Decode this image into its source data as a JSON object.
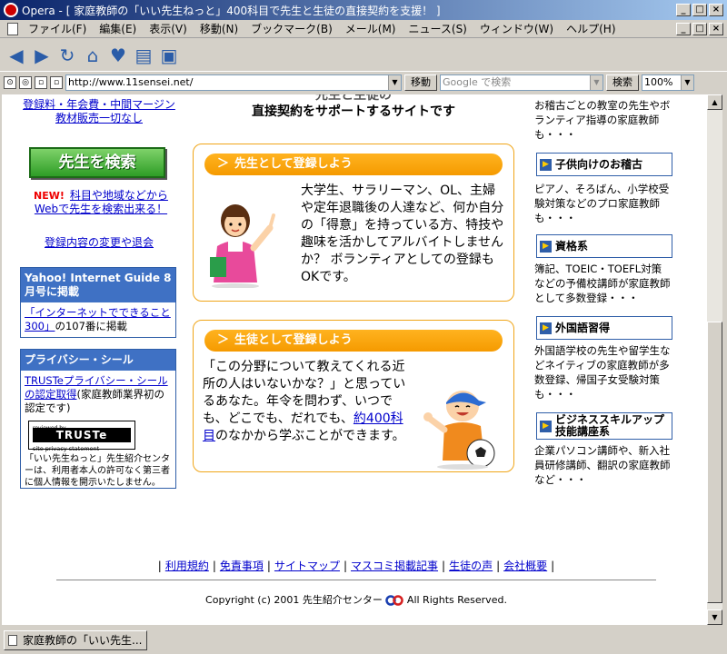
{
  "window": {
    "title": "Opera - [ 家庭教師の「いい先生ねっと」400科目で先生と生徒の直接契約を支援！ ]",
    "minimize": "_",
    "maximize": "□",
    "close": "×"
  },
  "menu": [
    "ファイル(F)",
    "編集(E)",
    "表示(V)",
    "移動(N)",
    "ブックマーク(B)",
    "メール(M)",
    "ニュース(S)",
    "ウィンドウ(W)",
    "ヘルプ(H)"
  ],
  "addressbar": {
    "url": "http://www.11sensei.net/",
    "go_label": "移動",
    "search_placeholder": "Google で検索",
    "search_label": "検索",
    "zoom": "100%"
  },
  "left": {
    "top_link_1": "登録料・年会費・中間マージン",
    "top_link_2": "教材販売一切なし",
    "search_button": "先生を検索",
    "new_badge": "NEW!",
    "new_text_1": "科目や地域などから",
    "new_text_2": "Webで先生を検索出来る！",
    "change_link": "登録内容の変更や退会",
    "yahoo_head": "Yahoo! Internet Guide 8月号に掲載",
    "yahoo_link": "「インターネットでできること300」",
    "yahoo_suffix": "の107番に掲載",
    "privacy_head": "プライバシー・シール",
    "truste_link": "TRUSTeプライバシー・シールの認定取得",
    "truste_suffix": "(家庭教師業界初の認定です)",
    "truste_reviewed": "reviewed by",
    "truste_logo": "TRUSTe",
    "truste_sub": "site privacy statement",
    "privacy_note": "「いい先生ねっと」先生紹介センターは、利用者本人の許可なく第三者に個人情報を開示いたしません。"
  },
  "center": {
    "head_line_1": "先生と生徒の",
    "head_line_2": "直接契約をサポートするサイトです",
    "teacher_title": "先生として登録しよう",
    "teacher_text": "大学生、サラリーマン、OL、主婦や定年退職後の人達など、何か自分の「得意」を持っている方、特技や趣味を活かしてアルバイトしませんか？ ボランティアとしての登録もOKです。",
    "student_title": "生徒として登録しよう",
    "student_text_1": "「この分野について教えてくれる近所の人はいないかな？」と思っているあなた。年令を問わず、いつでも、どこでも、だれでも、",
    "student_link": "約400科目",
    "student_text_2": "のなかから学ぶことができます。"
  },
  "right": {
    "top_text": "お稽古ごとの教室の先生やボランティア指導の家庭教師も・・・",
    "sections": [
      {
        "title": "子供向けのお稽古",
        "text": "ピアノ、そろばん、小学校受験対策などのプロ家庭教師も・・・"
      },
      {
        "title": "資格系",
        "text": "簿記、TOEIC・TOEFL対策などの予備校講師が家庭教師として多数登録・・・"
      },
      {
        "title": "外国語習得",
        "text": "外国語学校の先生や留学生などネイティブの家庭教師が多数登録、帰国子女受験対策も・・・"
      },
      {
        "title": "ビジネススキルアップ技能講座系",
        "text": "企業パソコン講師や、新入社員研修講師、翻訳の家庭教師など・・・"
      }
    ]
  },
  "footer": {
    "links": [
      "利用規約",
      "免責事項",
      "サイトマップ",
      "マスコミ掲載記事",
      "生徒の声",
      "会社概要"
    ],
    "copyright": "Copyright (c) 2001 先生紹介センター",
    "rights": "All Rights Reserved."
  },
  "status": {
    "tab_title": "家庭教師の「いい先生..."
  }
}
